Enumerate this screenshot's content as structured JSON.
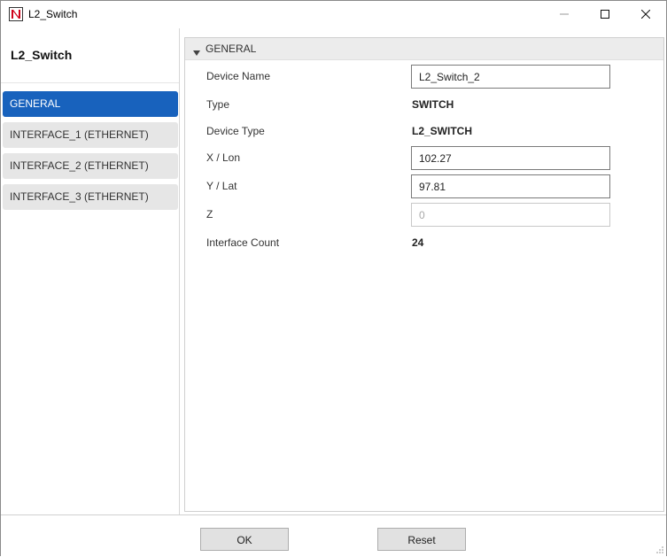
{
  "window": {
    "title": "L2_Switch",
    "icon": "app-logo-icon",
    "controls": {
      "minimize": "minimize-icon",
      "maximize": "maximize-icon",
      "close": "close-icon"
    }
  },
  "sidebar": {
    "device_title": "L2_Switch",
    "items": [
      {
        "label": "GENERAL",
        "active": true
      },
      {
        "label": "INTERFACE_1 (ETHERNET)",
        "active": false
      },
      {
        "label": "INTERFACE_2 (ETHERNET)",
        "active": false
      },
      {
        "label": "INTERFACE_3 (ETHERNET)",
        "active": false
      }
    ]
  },
  "general": {
    "section_title": "GENERAL",
    "device_name": {
      "label": "Device Name",
      "value": "L2_Switch_2"
    },
    "type": {
      "label": "Type",
      "value": "SWITCH"
    },
    "device_type": {
      "label": "Device Type",
      "value": "L2_SWITCH"
    },
    "x_lon": {
      "label": "X / Lon",
      "value": "102.27"
    },
    "y_lat": {
      "label": "Y / Lat",
      "value": "97.81"
    },
    "z": {
      "label": "Z",
      "value": "0"
    },
    "interface_count": {
      "label": "Interface Count",
      "value": "24"
    }
  },
  "footer": {
    "ok_label": "OK",
    "reset_label": "Reset"
  },
  "colors": {
    "accent": "#1862bd",
    "nav_inactive": "#e6e6e6",
    "logo_red": "#d0021b"
  }
}
